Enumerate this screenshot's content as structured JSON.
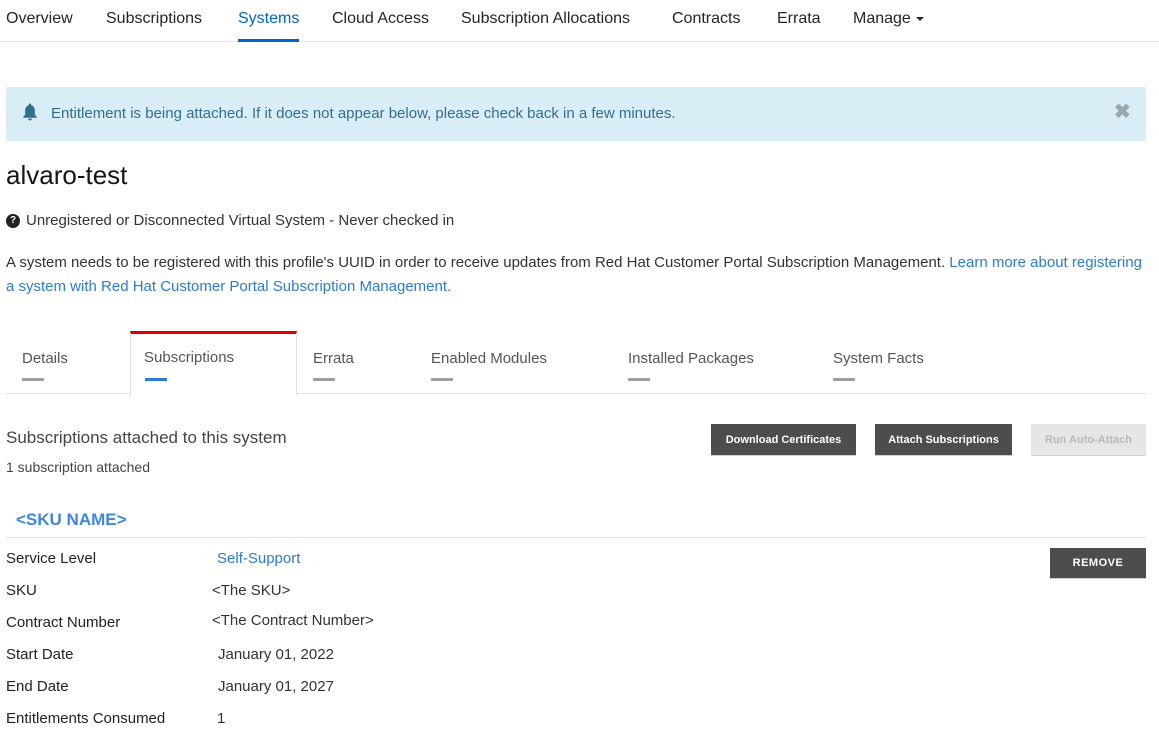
{
  "topnav": {
    "items": [
      {
        "label": "Overview"
      },
      {
        "label": "Subscriptions"
      },
      {
        "label": "Systems",
        "active": true
      },
      {
        "label": "Cloud Access"
      },
      {
        "label": "Subscription Allocations"
      },
      {
        "label": "Contracts"
      },
      {
        "label": "Errata"
      },
      {
        "label": "Manage",
        "dropdown": true
      }
    ]
  },
  "alert": {
    "icon": "bell-icon",
    "message": "Entitlement is being attached. If it does not appear below, please check back in a few minutes.",
    "close_glyph": "✖"
  },
  "system": {
    "name": "alvaro-test",
    "status_icon": "question-circle-icon",
    "status_glyph": "?",
    "status": "Unregistered or Disconnected Virtual System - Never checked in",
    "description": "A system needs to be registered with this profile's UUID in order to receive updates from Red Hat Customer Portal Subscription Management. ",
    "learn_more_link": "Learn more about registering a system with Red Hat Customer Portal Subscription Management."
  },
  "tabs": [
    {
      "label": "Details"
    },
    {
      "label": "Subscriptions",
      "active": true
    },
    {
      "label": "Errata"
    },
    {
      "label": "Enabled Modules"
    },
    {
      "label": "Installed Packages"
    },
    {
      "label": "System Facts"
    }
  ],
  "subscriptions_panel": {
    "title": "Subscriptions attached to this system",
    "count_text": "1 subscription attached",
    "buttons": {
      "download": "Download Certificates",
      "attach": "Attach Subscriptions",
      "auto_attach": "Run Auto-Attach"
    }
  },
  "subscription": {
    "sku_name": "<SKU NAME>",
    "remove_label": "REMOVE",
    "fields": [
      {
        "label": "Service Level",
        "value": "Self-Support"
      },
      {
        "label": "SKU",
        "value": "<The SKU>"
      },
      {
        "label": "Contract Number",
        "value": "<The Contract Number>"
      },
      {
        "label": "Start Date",
        "value": "January 01, 2022"
      },
      {
        "label": "End Date",
        "value": "January 01, 2027"
      },
      {
        "label": "Entitlements Consumed",
        "value": "1"
      }
    ]
  },
  "colors": {
    "accent": "#0066cc",
    "link": "#2b7bd6",
    "alert_bg": "#d9edf7",
    "alert_text": "#31708f",
    "active_tab_top": "#e00000",
    "dark_button": "#4d4d4d"
  }
}
